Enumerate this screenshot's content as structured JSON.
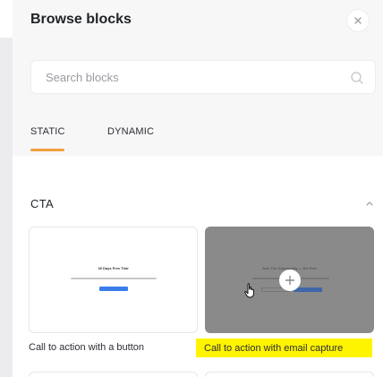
{
  "dialog": {
    "title": "Browse blocks"
  },
  "search": {
    "placeholder": "Search blocks"
  },
  "tabs": [
    {
      "label": "STATIC",
      "active": true
    },
    {
      "label": "DYNAMIC",
      "active": false
    }
  ],
  "section": {
    "title": "CTA",
    "expanded": true
  },
  "blocks": [
    {
      "caption": "Call to action with a button",
      "preview_title": "30 Days Free Trial",
      "highlighted": false
    },
    {
      "caption": "Call to action with email capture",
      "preview_title": "Join The Community — It's Free",
      "highlighted": true
    }
  ],
  "colors": {
    "accent": "#f0a040",
    "highlight": "#fff400",
    "preview_button": "#3b7de8"
  },
  "icons": {
    "close": "close-icon",
    "search": "search-icon",
    "chevron": "chevron-up-icon",
    "add": "plus-icon",
    "cursor": "hand-pointer-icon"
  }
}
